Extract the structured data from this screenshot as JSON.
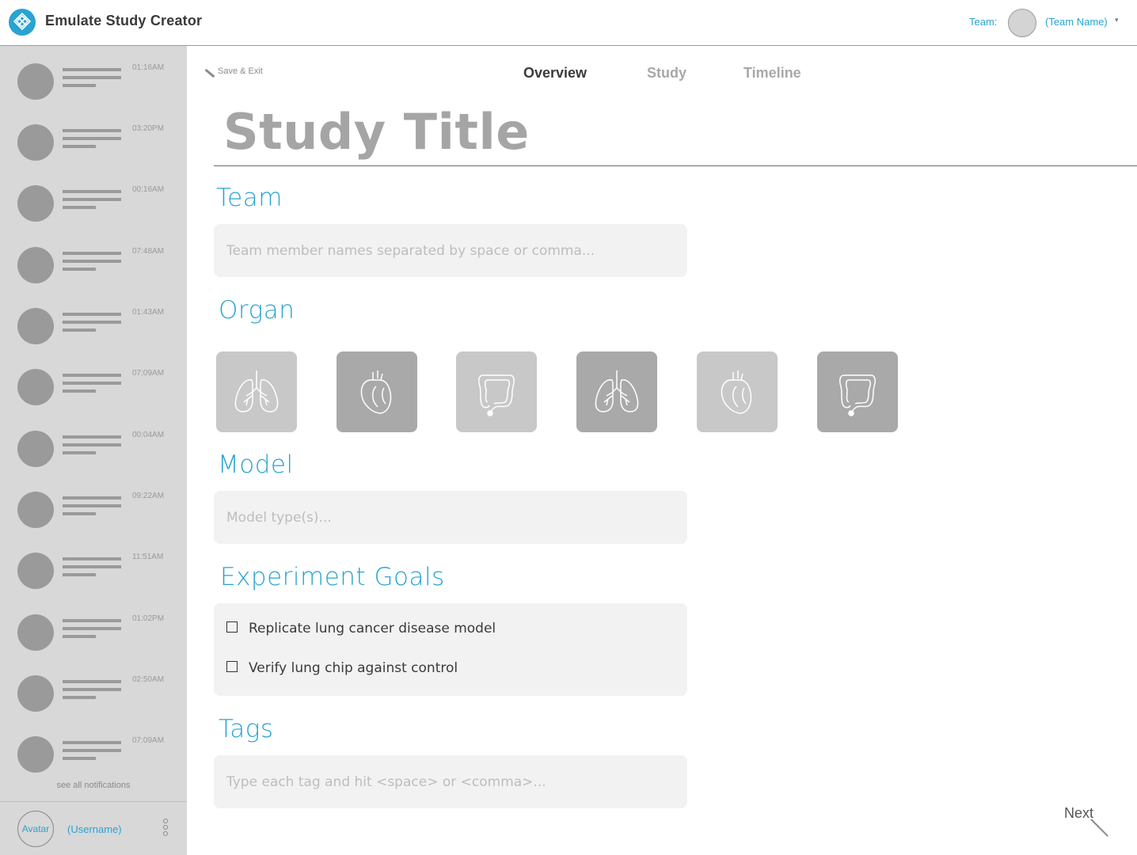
{
  "header": {
    "app_title": "Emulate Study Creator",
    "team_label": "Team:",
    "team_name": "(Team Name)"
  },
  "sidebar": {
    "notifications": [
      {
        "time": "01:16AM"
      },
      {
        "time": "03:20PM"
      },
      {
        "time": "00:16AM"
      },
      {
        "time": "07:48AM"
      },
      {
        "time": "01:43AM"
      },
      {
        "time": "07:09AM"
      },
      {
        "time": "00:04AM"
      },
      {
        "time": "09:22AM"
      },
      {
        "time": "11:51AM"
      },
      {
        "time": "01:02PM"
      },
      {
        "time": "02:50AM"
      },
      {
        "time": "07:09AM"
      }
    ],
    "see_all": "see all notifications",
    "avatar_label": "Avatar",
    "username": "(Username)"
  },
  "toolbar": {
    "save_exit": "Save & Exit"
  },
  "tabs": {
    "overview": "Overview",
    "study": "Study",
    "timeline": "Timeline"
  },
  "form": {
    "title": "Study Title",
    "team_label": "Team",
    "team_placeholder": "Team member names separated by space or comma...",
    "organ_label": "Organ",
    "organs": [
      {
        "icon": "lungs-icon",
        "shade": "light"
      },
      {
        "icon": "heart-icon",
        "shade": "dark"
      },
      {
        "icon": "intestine-icon",
        "shade": "light"
      },
      {
        "icon": "lungs-icon",
        "shade": "dark"
      },
      {
        "icon": "heart-icon",
        "shade": "light"
      },
      {
        "icon": "intestine-icon",
        "shade": "dark"
      }
    ],
    "model_label": "Model",
    "model_placeholder": "Model type(s)...",
    "goals_label": "Experiment Goals",
    "goals": [
      {
        "label": "Replicate lung cancer disease model",
        "checked": false
      },
      {
        "label": "Verify lung chip against control",
        "checked": false
      }
    ],
    "tags_label": "Tags",
    "tags_placeholder": "Type each tag and hit <space> or <comma>..."
  },
  "footer": {
    "next_label": "Next"
  },
  "colors": {
    "accent": "#29a3d1",
    "sidebar_bg": "#d8d8d8",
    "field_bg": "#f2f2f2"
  }
}
